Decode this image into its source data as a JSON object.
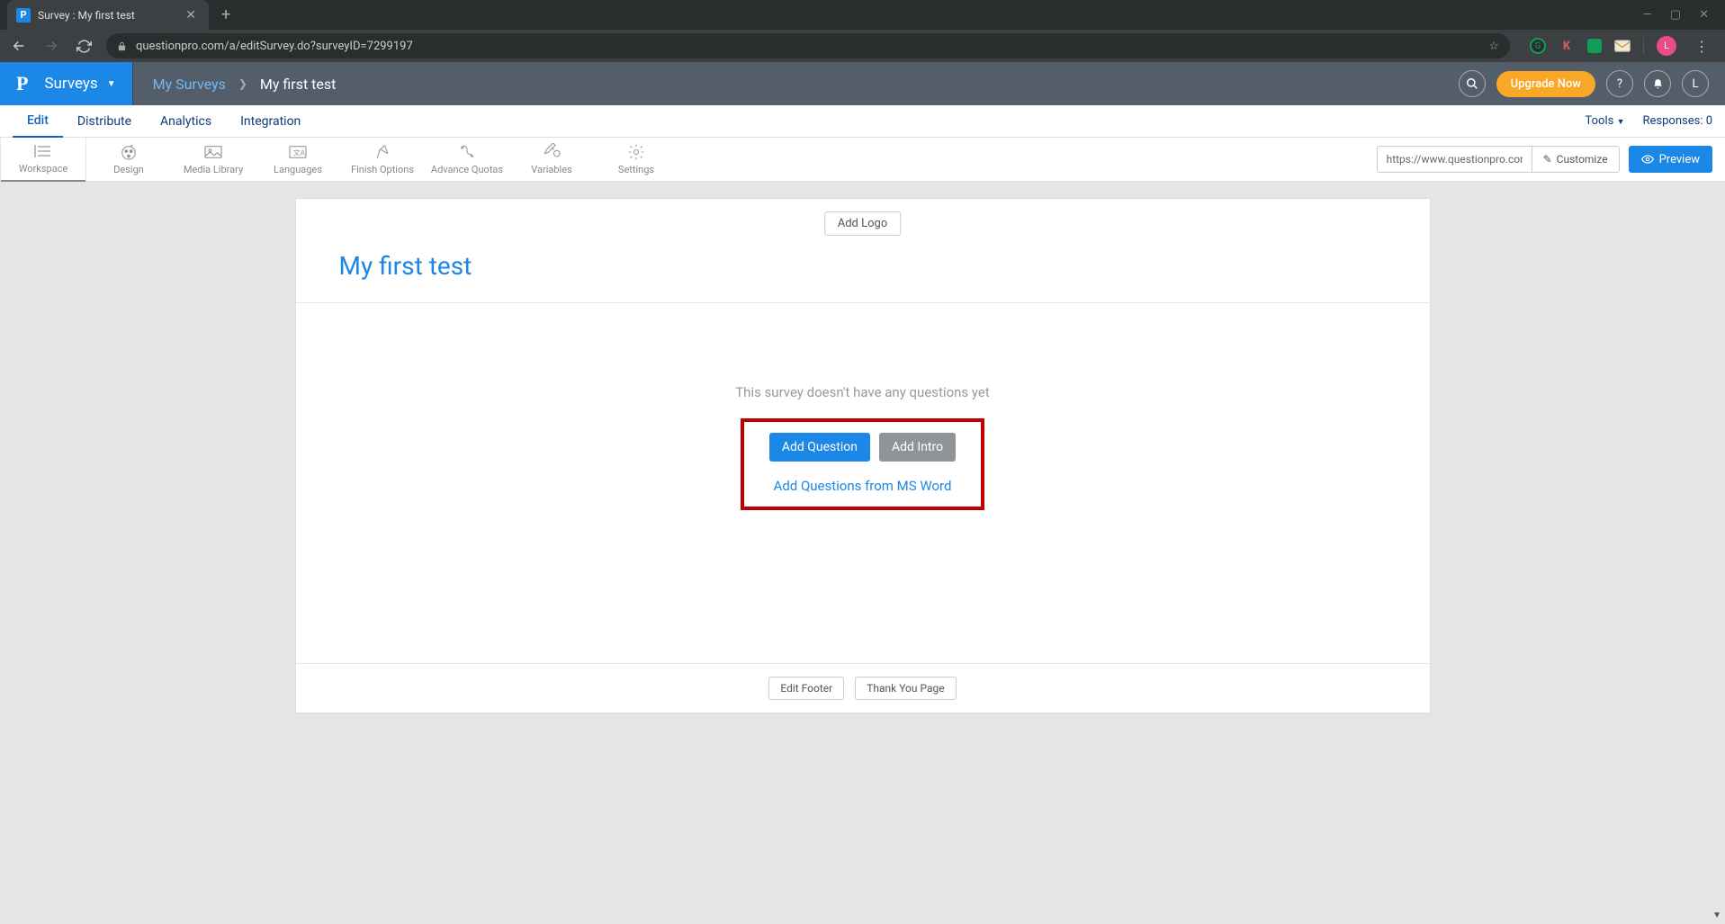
{
  "browser": {
    "tab_title": "Survey : My first test",
    "url": "questionpro.com/a/editSurvey.do?surveyID=7299197",
    "avatar_letter": "L",
    "ext_k": "K"
  },
  "header": {
    "surveys_label": "Surveys",
    "breadcrumb_link": "My Surveys",
    "breadcrumb_current": "My first test",
    "upgrade_label": "Upgrade Now",
    "avatar_letter": "L"
  },
  "subnav": {
    "items": [
      "Edit",
      "Distribute",
      "Analytics",
      "Integration"
    ],
    "tools_label": "Tools",
    "responses_label": "Responses: 0"
  },
  "toolbar": {
    "items": [
      "Workspace",
      "Design",
      "Media Library",
      "Languages",
      "Finish Options",
      "Advance Quotas",
      "Variables",
      "Settings"
    ],
    "url_value": "https://www.questionpro.com",
    "customize_label": "Customize",
    "preview_label": "Preview"
  },
  "survey": {
    "add_logo_label": "Add Logo",
    "title": "My first test",
    "empty_text": "This survey doesn't have any questions yet",
    "add_question_label": "Add Question",
    "add_intro_label": "Add Intro",
    "msword_link": "Add Questions from MS Word",
    "edit_footer_label": "Edit Footer",
    "thank_you_label": "Thank You Page"
  }
}
